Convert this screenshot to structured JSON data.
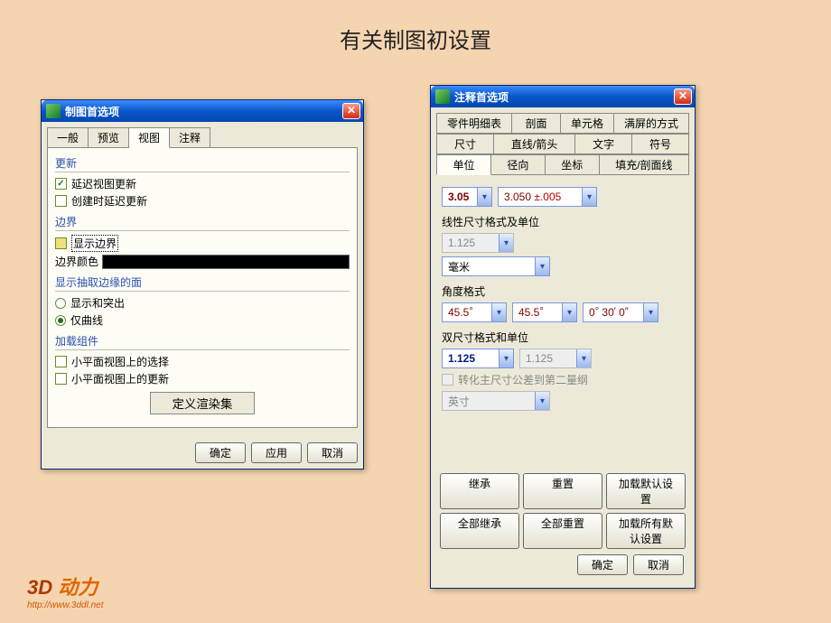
{
  "page_title": "有关制图初设置",
  "dlg1": {
    "title": "制图首选项",
    "tabs": [
      "一般",
      "预览",
      "视图",
      "注释"
    ],
    "active_tab": "视图",
    "update": {
      "title": "更新",
      "delay_update": "延迟视图更新",
      "create_update": "创建时延迟更新"
    },
    "border": {
      "title": "边界",
      "show_border": "显示边界",
      "color_label": "边界颜色"
    },
    "edges": {
      "title": "显示抽取边缘的面",
      "show_highlight": "显示和突出",
      "curves_only": "仅曲线"
    },
    "components": {
      "title": "加载组件",
      "small_select": "小平面视图上的选择",
      "small_update": "小平面视图上的更新"
    },
    "render_button": "定义渲染集",
    "ok": "确定",
    "apply": "应用",
    "cancel": "取消"
  },
  "dlg2": {
    "title": "注释首选项",
    "tabs_row1": [
      "零件明细表",
      "剖面",
      "单元格",
      "满屏的方式"
    ],
    "tabs_row2": [
      "尺寸",
      "直线/箭头",
      "文字",
      "符号"
    ],
    "tabs_row3": [
      "单位",
      "径向",
      "坐标",
      "填充/剖面线"
    ],
    "active_tab": "单位",
    "val_305": "3.05",
    "val_305tol": "3.050 ±.005",
    "linear_label": "线性尺寸格式及单位",
    "val_1125": "1.125",
    "mm": "毫米",
    "angle_label": "角度格式",
    "angle1": "45.5",
    "angle2": "45.5",
    "angle3": "0 30 0",
    "dual_label": "双尺寸格式和单位",
    "dual1": "1.125",
    "dual2": "1.125",
    "convert_tol": "转化主尺寸公差到第二量纲",
    "inch": "英寸",
    "inherit": "继承",
    "reset": "重置",
    "load_default": "加载默认设置",
    "inherit_all": "全部继承",
    "reset_all": "全部重置",
    "load_all_default": "加载所有默认设置",
    "ok": "确定",
    "cancel": "取消"
  },
  "logo": {
    "brand": "3D 动力",
    "url": "http://www.3ddl.net"
  }
}
